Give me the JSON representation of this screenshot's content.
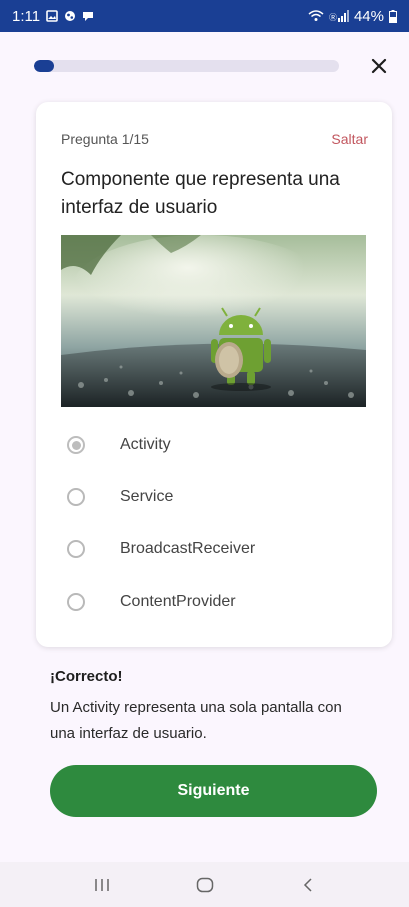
{
  "status_bar": {
    "time": "1:11",
    "battery": "44%"
  },
  "progress": {
    "fraction": 0.067,
    "color": "#1a3f94"
  },
  "card": {
    "question_counter": "Pregunta 1/15",
    "skip_label": "Saltar",
    "question": "Componente que representa una interfaz de usuario",
    "options": [
      {
        "label": "Activity",
        "selected": true
      },
      {
        "label": "Service",
        "selected": false
      },
      {
        "label": "BroadcastReceiver",
        "selected": false
      },
      {
        "label": "ContentProvider",
        "selected": false
      }
    ]
  },
  "feedback": {
    "title": "¡Correcto!",
    "text": "Un Activity representa una sola pantalla con una interfaz de usuario."
  },
  "next_button": {
    "label": "Siguiente",
    "color": "#2e8a3e"
  },
  "nav_bar": {
    "icons": [
      "recent-apps-icon",
      "home-icon",
      "back-icon"
    ]
  }
}
